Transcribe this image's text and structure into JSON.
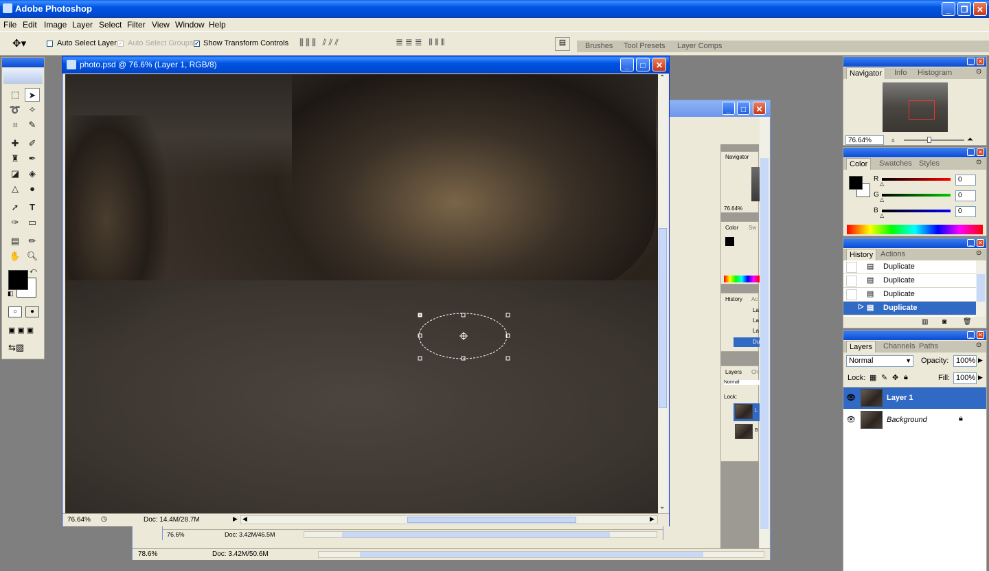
{
  "app": {
    "title": "Adobe Photoshop"
  },
  "menu": [
    "File",
    "Edit",
    "Image",
    "Layer",
    "Select",
    "Filter",
    "View",
    "Window",
    "Help"
  ],
  "options_bar": {
    "auto_select_layer": "Auto Select Layer",
    "auto_select_layer_checked": false,
    "auto_select_groups": "Auto Select Groups",
    "show_transform_controls": "Show Transform Controls",
    "show_transform_controls_checked": true
  },
  "palette_well": {
    "tabs": [
      "Brushes",
      "Tool Presets",
      "Layer Comps"
    ]
  },
  "document": {
    "title": "photo.psd @ 76.6% (Layer 1, RGB/8)",
    "zoom": "76.64%",
    "doc_size": "Doc: 14.4M/28.7M"
  },
  "background_docs": [
    {
      "zoom": "76.6%",
      "doc_size": "Doc: 3.42M/46.5M"
    },
    {
      "zoom": "78.6%",
      "doc_size": "Doc: 3.42M/50.6M"
    }
  ],
  "mini_panels": {
    "navigator": "Navigator",
    "navigator_zoom": "76.64%",
    "color": "Color",
    "color_tab2": "Sw",
    "history": "History",
    "history_tab2": "Ac",
    "history_items": [
      "La",
      "La",
      "La",
      "Du"
    ],
    "layers": "Layers",
    "layers_tab2": "Ch",
    "blend": "Normal",
    "lock": "Lock:",
    "layer_names": [
      "L",
      "B"
    ]
  },
  "navigator_panel": {
    "tabs": [
      "Navigator",
      "Info",
      "Histogram"
    ],
    "zoom": "76.64%"
  },
  "color_panel": {
    "tabs": [
      "Color",
      "Swatches",
      "Styles"
    ],
    "channels": [
      {
        "label": "R",
        "value": "0",
        "color": "#ff0000"
      },
      {
        "label": "G",
        "value": "0",
        "color": "#00cc00"
      },
      {
        "label": "B",
        "value": "0",
        "color": "#0000ff"
      }
    ]
  },
  "history_panel": {
    "tabs": [
      "History",
      "Actions"
    ],
    "items": [
      "Duplicate",
      "Duplicate",
      "Duplicate",
      "Duplicate"
    ],
    "active_index": 3
  },
  "layers_panel": {
    "tabs": [
      "Layers",
      "Channels",
      "Paths"
    ],
    "blend_mode": "Normal",
    "opacity_label": "Opacity:",
    "opacity": "100%",
    "lock_label": "Lock:",
    "fill_label": "Fill:",
    "fill": "100%",
    "layers": [
      {
        "name": "Layer 1",
        "active": true
      },
      {
        "name": "Background",
        "active": false
      }
    ]
  },
  "colors": {
    "xp_blue": "#0054e3",
    "selection_blue": "#316ac5",
    "panel_bg": "#ece9d8",
    "foreground": "#000000",
    "background": "#ffffff"
  }
}
